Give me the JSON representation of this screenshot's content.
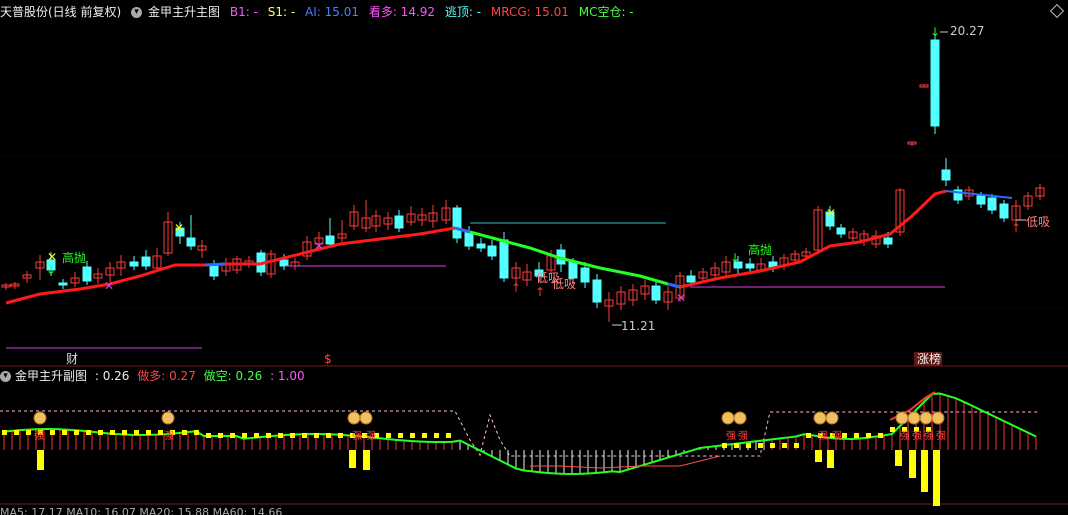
{
  "header": {
    "stock": "天普股份(日线 前复权)",
    "indicator": "金甲主升主图",
    "b1": "B1: -",
    "s1": "S1: -",
    "ai": "AI: 15.01",
    "kanduo": "看多: 14.92",
    "taoding": "逃顶: -",
    "mrcg": "MRCG: 15.01",
    "mc": "MC空仓: -"
  },
  "sub_header": {
    "name": "金甲主升副图",
    "value": ": 0.26",
    "zuoduo": "做多: 0.27",
    "zuokong": "做空: 0.26",
    "ratio": ": 1.00"
  },
  "annotations": {
    "high1": "高抛",
    "high2": "高抛",
    "low1": "低吸",
    "low2": "低吸",
    "low3": "低吸",
    "low_price": "11.21",
    "high_price": "20.27",
    "cai": "财",
    "dollar": "$",
    "zhangbang": "涨榜",
    "qiang": "强"
  },
  "colors": {
    "up": "#ff3b3b",
    "down": "#54ffff",
    "ma_red": "#ff1a1a",
    "ma_green": "#22ff22",
    "magenta": "#e040e0",
    "yellow": "#ffff00"
  },
  "footer": "MA5: 17.17 MA10: 16.07 MA20: 15.88 MA60: 14.66"
}
